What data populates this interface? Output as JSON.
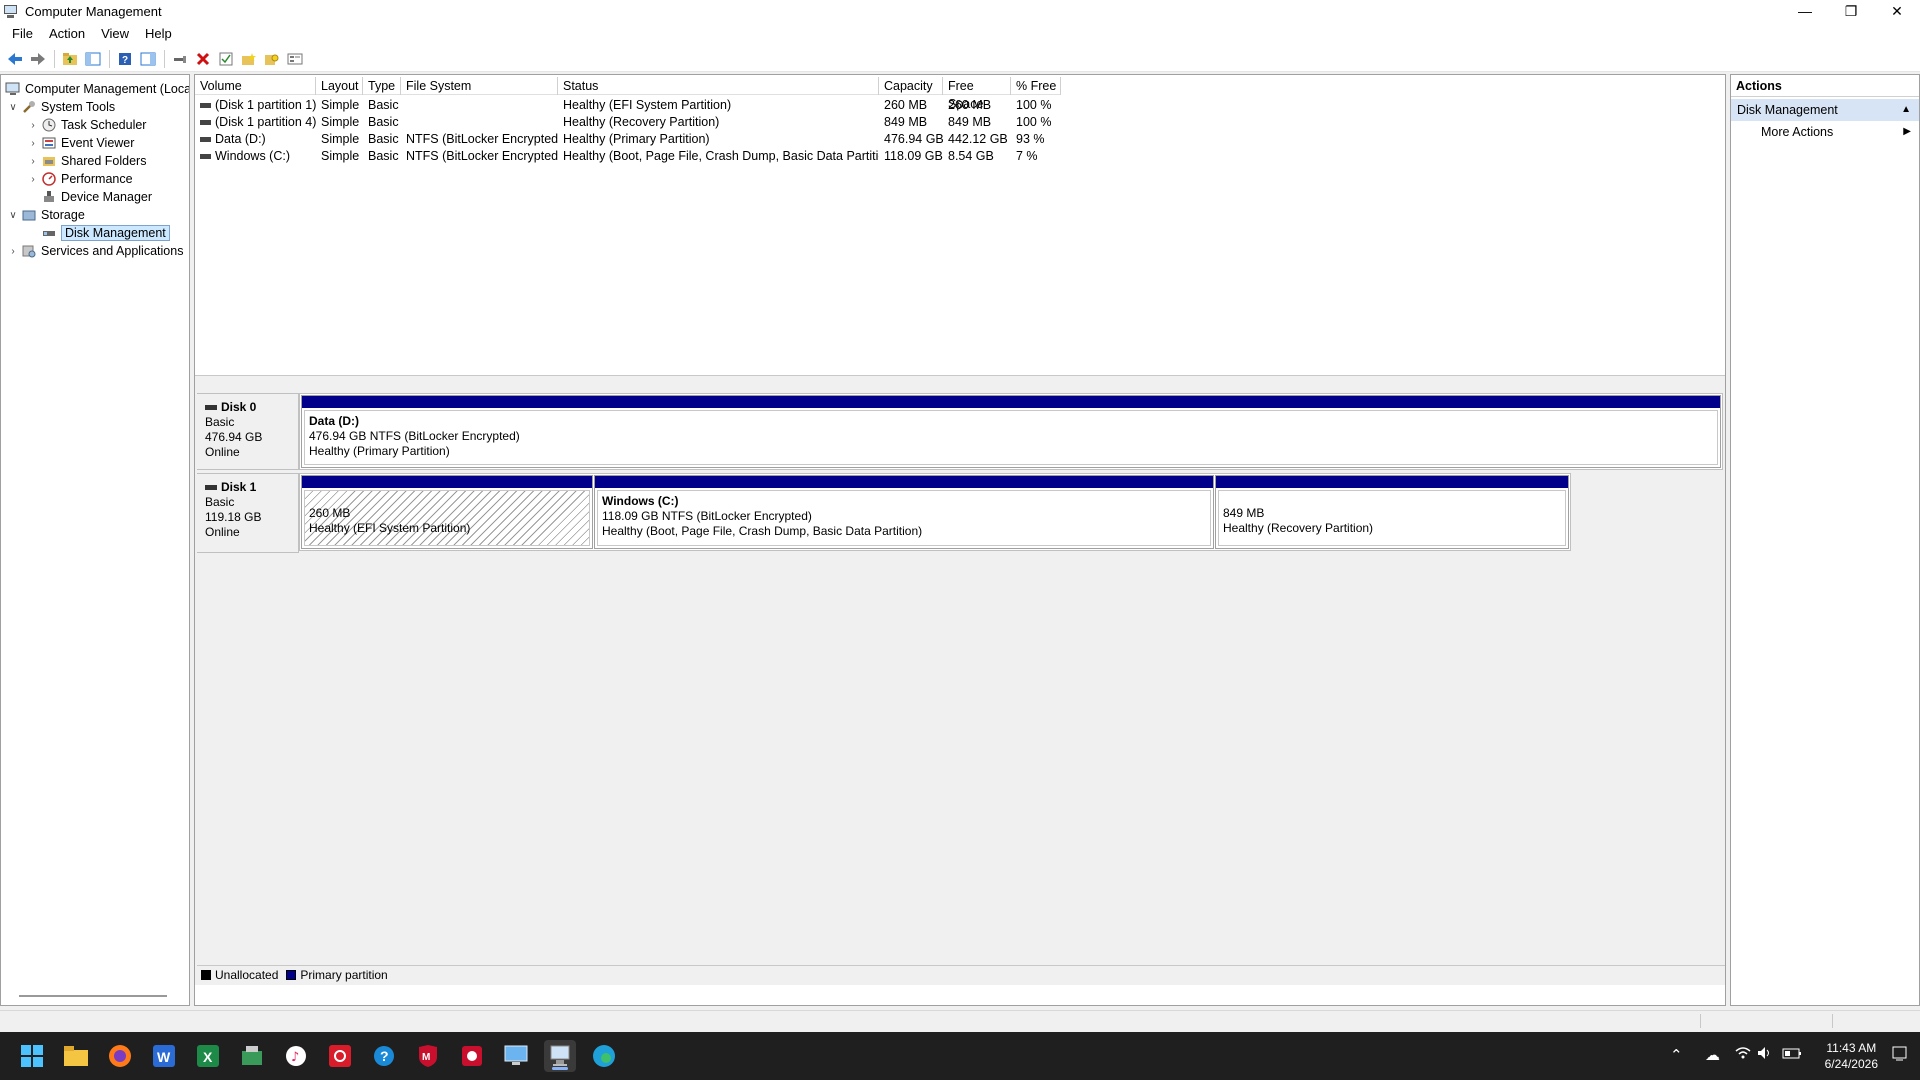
{
  "window": {
    "title": "Computer Management"
  },
  "menu": [
    "File",
    "Action",
    "View",
    "Help"
  ],
  "toolbar": {
    "icons": [
      "back-arrow-icon",
      "forward-arrow-icon",
      "up-folder-icon",
      "show-hide-tree-icon",
      "help-icon",
      "show-action-pane-icon",
      "connect-icon",
      "delete-icon",
      "check-icon",
      "new-folder-icon",
      "properties-icon",
      "view-icon"
    ]
  },
  "tree": {
    "root": "Computer Management (Local",
    "system_tools": "System Tools",
    "task_scheduler": "Task Scheduler",
    "event_viewer": "Event Viewer",
    "shared_folders": "Shared Folders",
    "performance": "Performance",
    "device_manager": "Device Manager",
    "storage": "Storage",
    "disk_management": "Disk Management",
    "services": "Services and Applications"
  },
  "volumes": {
    "headers": [
      "Volume",
      "Layout",
      "Type",
      "File System",
      "Status",
      "Capacity",
      "Free Space",
      "% Free"
    ],
    "rows": [
      [
        "(Disk 1 partition 1)",
        "Simple",
        "Basic",
        "",
        "Healthy (EFI System Partition)",
        "260 MB",
        "260 MB",
        "100 %"
      ],
      [
        "(Disk 1 partition 4)",
        "Simple",
        "Basic",
        "",
        "Healthy (Recovery Partition)",
        "849 MB",
        "849 MB",
        "100 %"
      ],
      [
        "Data (D:)",
        "Simple",
        "Basic",
        "NTFS (BitLocker Encrypted)",
        "Healthy (Primary Partition)",
        "476.94 GB",
        "442.12 GB",
        "93 %"
      ],
      [
        "Windows (C:)",
        "Simple",
        "Basic",
        "NTFS (BitLocker Encrypted)",
        "Healthy (Boot, Page File, Crash Dump, Basic Data Partition)",
        "118.09 GB",
        "8.54 GB",
        "7 %"
      ]
    ]
  },
  "disks": {
    "disk0": {
      "name": "Disk 0",
      "type": "Basic",
      "size": "476.94 GB",
      "state": "Online",
      "partitions": [
        {
          "name": "Data  (D:)",
          "detail": "476.94 GB NTFS (BitLocker Encrypted)",
          "status": "Healthy (Primary Partition)"
        }
      ]
    },
    "disk1": {
      "name": "Disk 1",
      "type": "Basic",
      "size": "119.18 GB",
      "state": "Online",
      "partitions": [
        {
          "name": "",
          "detail": "260 MB",
          "status": "Healthy (EFI System Partition)"
        },
        {
          "name": "Windows  (C:)",
          "detail": "118.09 GB NTFS (BitLocker Encrypted)",
          "status": "Healthy (Boot, Page File, Crash Dump, Basic Data Partition)"
        },
        {
          "name": "",
          "detail": "849 MB",
          "status": "Healthy (Recovery Partition)"
        }
      ]
    }
  },
  "legend": {
    "unallocated": "Unallocated",
    "unallocated_color": "#000000",
    "primary": "Primary partition",
    "primary_color": "#00008b"
  },
  "actions": {
    "header": "Actions",
    "section": "Disk Management",
    "more": "More Actions"
  },
  "taskbar": {
    "apps": [
      "start-icon",
      "file-explorer-icon",
      "firefox-icon",
      "word-icon",
      "excel-icon",
      "app-icon",
      "itunes-icon",
      "acrobat-icon",
      "help-icon",
      "mcafee-icon",
      "security-icon",
      "remote-desktop-icon",
      "computer-management-icon",
      "edge-icon"
    ],
    "time": "11:43 AM",
    "date": "6/24/2026"
  }
}
